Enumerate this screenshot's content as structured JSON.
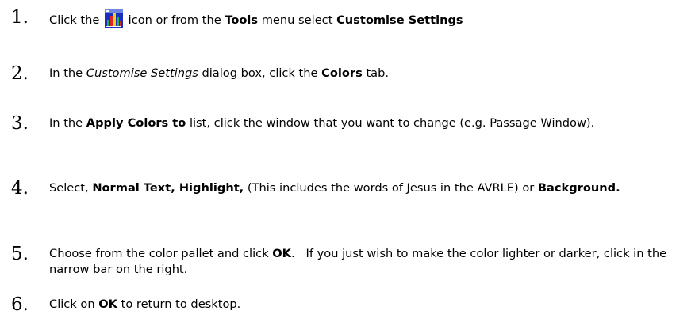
{
  "steps": [
    {
      "number": "1.",
      "parts": [
        "Click the",
        "icon or from the",
        "Tools",
        "menu select",
        "Customise Settings"
      ]
    },
    {
      "number": "2.",
      "parts": [
        "In the",
        "Customise Settings",
        "dialog box, click the",
        "Colors",
        "tab."
      ]
    },
    {
      "number": "3.",
      "parts": [
        "In the",
        "Apply Colors to",
        "list, click the window that you want to change (e.g. Passage Window)."
      ]
    },
    {
      "number": "4.",
      "parts": [
        "Select,",
        "Normal Text, Highlight,",
        "(This includes the words of Jesus in the AVRLE) or",
        "Background."
      ]
    },
    {
      "number": "5.",
      "parts": [
        "Choose from the color pallet and click",
        "OK",
        ".   If you just wish to make the color lighter or darker, click in the narrow bar on the right."
      ]
    },
    {
      "number": "6.",
      "parts": [
        "Click on",
        "OK",
        "to return to desktop."
      ]
    }
  ],
  "icons": {
    "step1_icon": "customise-settings-icon"
  },
  "colors": {
    "text": "#000000",
    "background": "#ffffff",
    "icon_blue": "#1a2fbf",
    "icon_green": "#22b14c",
    "icon_red": "#e0202a",
    "icon_yellow": "#f0d020"
  }
}
